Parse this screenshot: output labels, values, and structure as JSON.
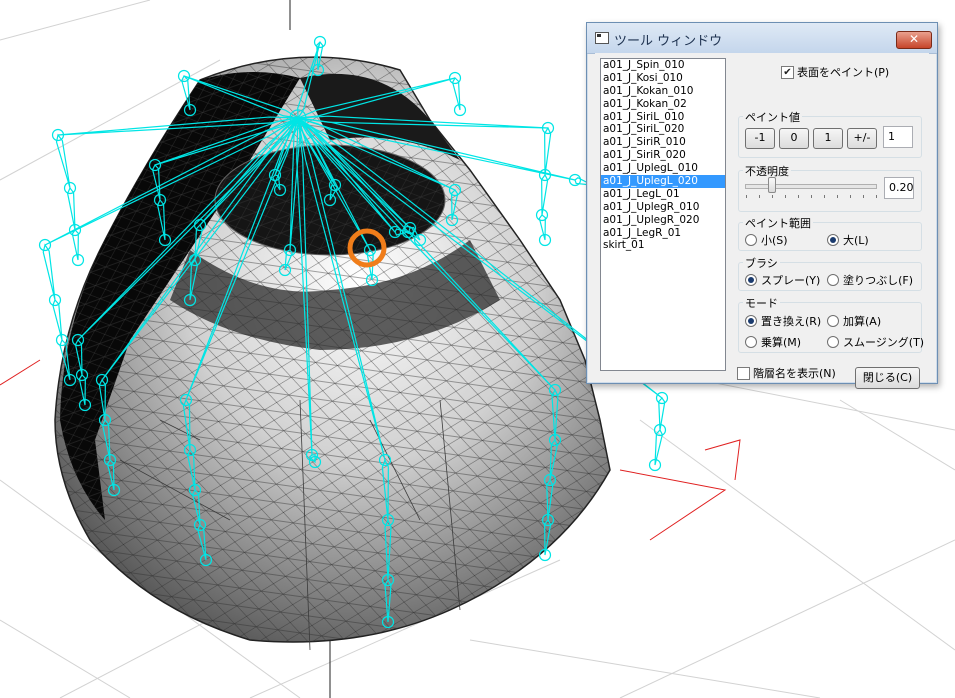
{
  "window": {
    "title": "ツール ウィンドウ",
    "close_label": "✕"
  },
  "bones": [
    "a01_J_Spin_010",
    "a01_J_Kosi_010",
    "a01_J_Kokan_010",
    "a01_J_Kokan_02",
    "a01_J_SiriL_010",
    "a01_J_SiriL_020",
    "a01_J_SiriR_010",
    "a01_J_SiriR_020",
    "a01_J_UplegL_010",
    "a01_J_UplegL_020",
    "a01_J_LegL_01",
    "a01_J_UplegR_010",
    "a01_J_UplegR_020",
    "a01_J_LegR_01",
    "skirt_01"
  ],
  "selected_bone": "a01_J_UplegL_020",
  "paint_surface": {
    "label": "表面をペイント(P)",
    "checked": true
  },
  "paint_value": {
    "label": "ペイント値",
    "buttons": [
      "-1",
      "0",
      "1",
      "+/-"
    ],
    "value": "1"
  },
  "opacity": {
    "label": "不透明度",
    "value": "0.20",
    "level": 0.2
  },
  "paint_range": {
    "label": "ペイント範囲",
    "small": "小(S)",
    "large": "大(L)",
    "selected": "large"
  },
  "brush": {
    "label": "ブラシ",
    "spray": "スプレー(Y)",
    "fill": "塗りつぶし(F)",
    "selected": "spray"
  },
  "mode": {
    "label": "モード",
    "replace": "置き換え(R)",
    "add": "加算(A)",
    "multiply": "乗算(M)",
    "smooth": "スムージング(T)",
    "selected": "replace"
  },
  "show_hierarchy": {
    "label": "階層名を表示(N)",
    "checked": false
  },
  "close_button": "閉じる(C)",
  "colors": {
    "bone": "#00e5e5",
    "brush_cursor": "#f07d1a",
    "axis": "#e02020",
    "selection": "#3399ff"
  }
}
